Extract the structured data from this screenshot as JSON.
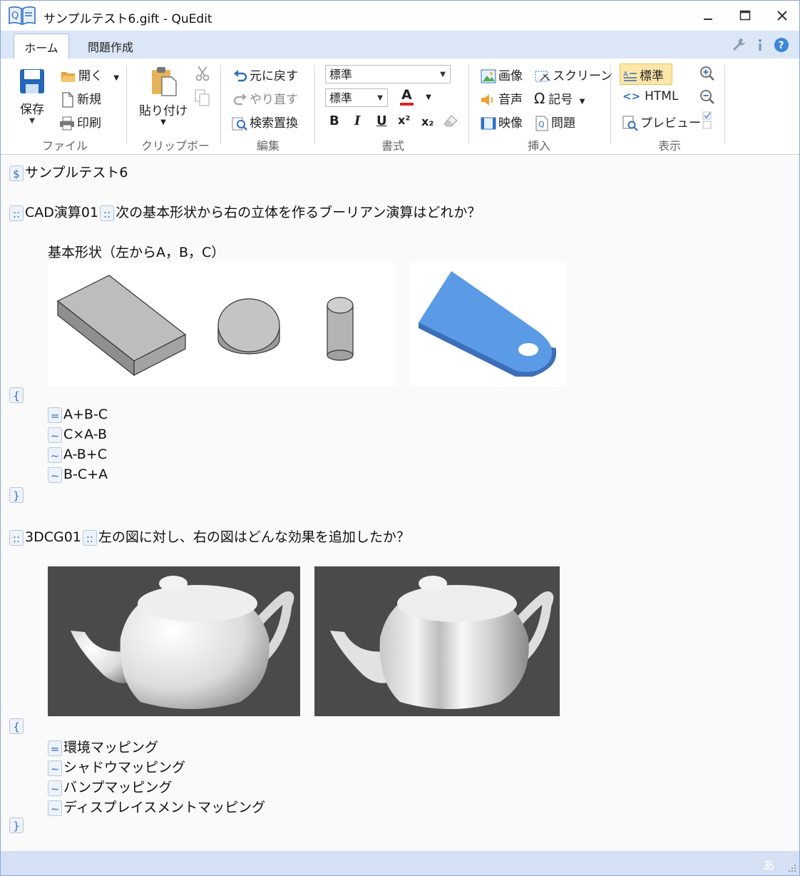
{
  "window": {
    "title": "サンプルテスト6.gift - QuEdit"
  },
  "tabs": [
    {
      "label": "ホーム"
    },
    {
      "label": "問題作成"
    }
  ],
  "ribbon": {
    "file": {
      "save": "保存",
      "open": "開く",
      "new": "新規",
      "print": "印刷",
      "group": "ファイル"
    },
    "clipboard": {
      "paste": "貼り付け",
      "group": "クリップボード"
    },
    "edit": {
      "undo": "元に戻す",
      "redo": "やり直す",
      "find_replace": "検索置換",
      "group": "編集"
    },
    "format": {
      "style_value": "標準",
      "size_value": "標準",
      "bold": "B",
      "italic": "I",
      "underline": "U",
      "font_color": "A",
      "superscript": "x²",
      "subscript": "x₂",
      "group": "書式"
    },
    "insert": {
      "image": "画像",
      "screen": "スクリーン",
      "audio": "音声",
      "symbol": "記号",
      "video": "映像",
      "question": "問題",
      "group": "挿入"
    },
    "view": {
      "standard": "標準",
      "html": "HTML",
      "preview": "プレビュー",
      "group": "表示"
    }
  },
  "doc": {
    "title": "サンプルテスト6",
    "q1": {
      "name": "CAD演算01",
      "question": "次の基本形状から右の立体を作るブーリアン演算はどれか？",
      "subtext": "基本形状（左からA，B，C）",
      "answers": [
        {
          "mark": "=",
          "text": "A+B-C"
        },
        {
          "mark": "~",
          "text": "C×A-B"
        },
        {
          "mark": "~",
          "text": "A-B+C"
        },
        {
          "mark": "~",
          "text": "B-C+A"
        }
      ]
    },
    "q2": {
      "name": "3DCG01",
      "question": "左の図に対し、右の図はどんな効果を追加したか？",
      "answers": [
        {
          "mark": "=",
          "text": "環境マッピング"
        },
        {
          "mark": "~",
          "text": "シャドウマッピング"
        },
        {
          "mark": "~",
          "text": "バンプマッピング"
        },
        {
          "mark": "~",
          "text": "ディスプレイスメントマッピング"
        }
      ]
    },
    "markers": {
      "title": "$",
      "q": "::",
      "open": "{",
      "close": "}"
    }
  },
  "status": {
    "ime": "あ"
  },
  "colors": {
    "accent": "#2f6fc0",
    "tabstrip": "#dbe6f7",
    "statusbar": "#d6e0f4",
    "solid_blue": "#5b9be6"
  }
}
